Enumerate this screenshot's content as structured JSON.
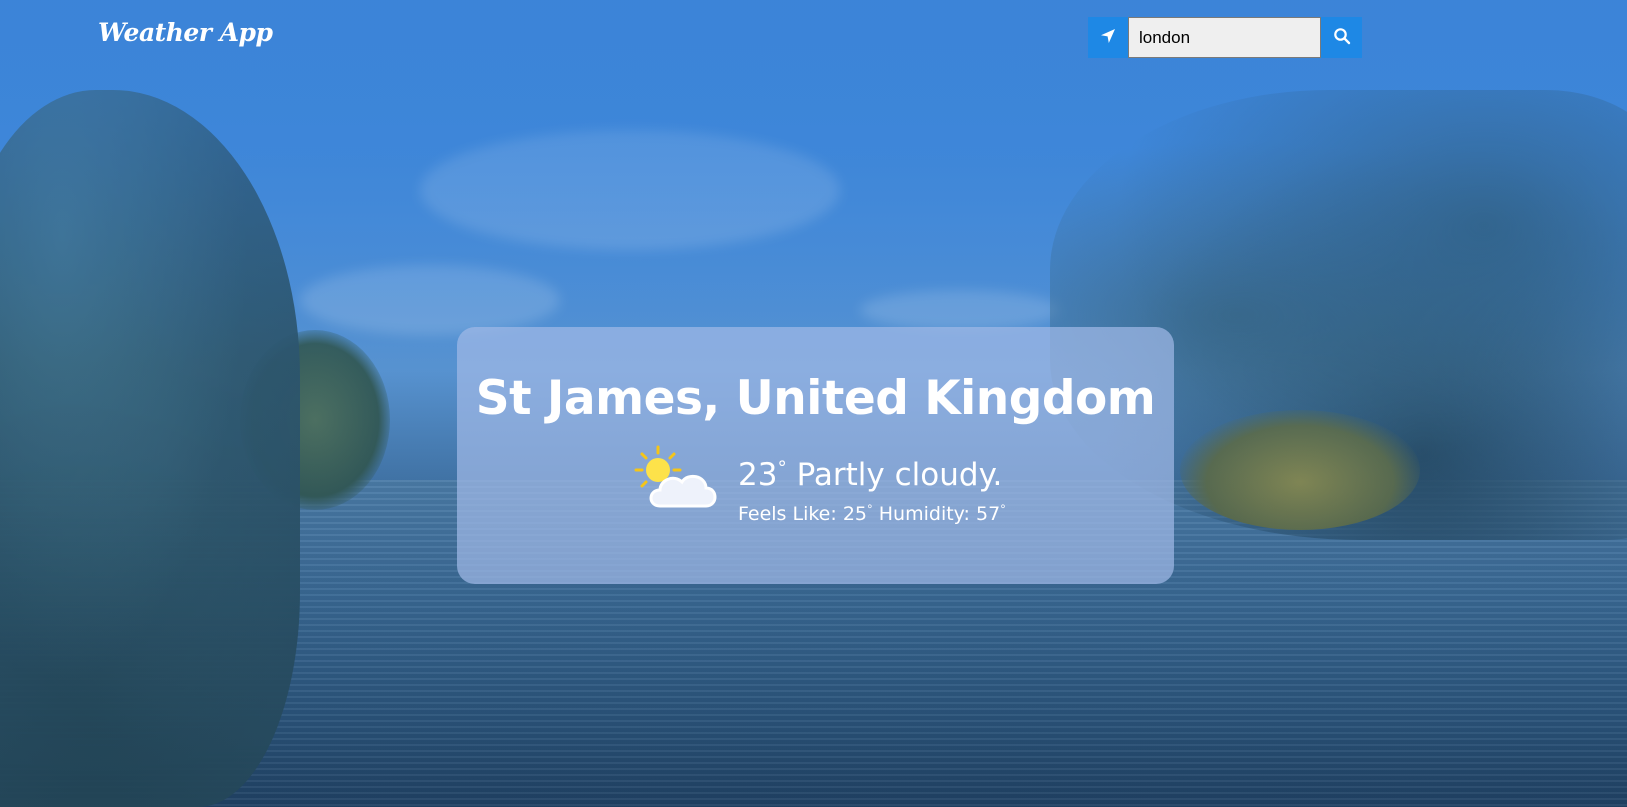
{
  "header": {
    "logo": "Weather App",
    "search_value": "london"
  },
  "card": {
    "location": "St James, United Kingdom",
    "temperature": "23",
    "condition": "Partly cloudy.",
    "feels_like_label": "Feels Like:",
    "feels_like_value": "25",
    "humidity_label": "Humidity:",
    "humidity_value": "57",
    "degree_symbol": "°"
  },
  "icons": {
    "locate": "location-arrow-icon",
    "search": "search-icon",
    "weather": "partly-cloudy-icon"
  },
  "colors": {
    "accent": "#1e88e5",
    "card_bg": "#a0b9e6",
    "sky": "#3a86d6"
  }
}
